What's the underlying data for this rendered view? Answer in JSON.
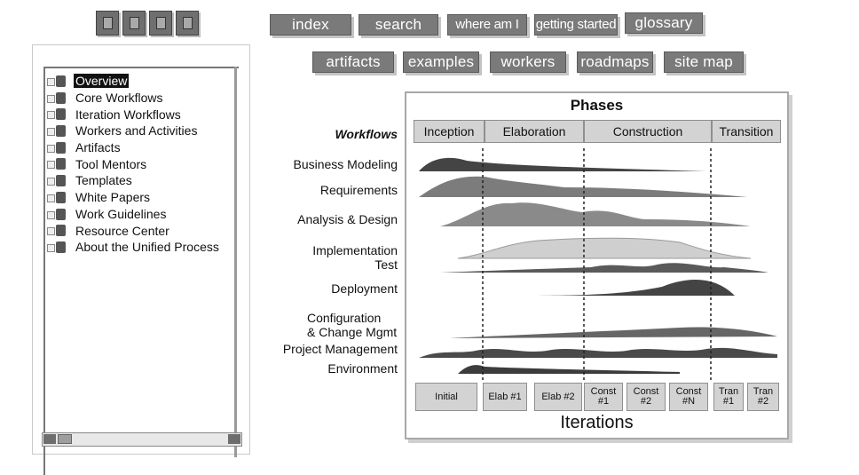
{
  "toolbar": {
    "icons": [
      "toolbar-icon-1",
      "toolbar-icon-2",
      "toolbar-icon-3",
      "toolbar-icon-4"
    ]
  },
  "nav": {
    "row1": [
      "index",
      "search",
      "where am I",
      "getting started",
      "glossary"
    ],
    "row2": [
      "artifacts",
      "examples",
      "workers",
      "roadmaps",
      "site map"
    ]
  },
  "tree": {
    "items": [
      {
        "label": "Overview",
        "selected": true
      },
      {
        "label": "Core Workflows"
      },
      {
        "label": "Iteration Workflows"
      },
      {
        "label": "Workers and Activities"
      },
      {
        "label": "Artifacts"
      },
      {
        "label": "Tool Mentors"
      },
      {
        "label": "Templates"
      },
      {
        "label": "White Papers"
      },
      {
        "label": "Work Guidelines"
      },
      {
        "label": "Resource Center"
      },
      {
        "label": "About the Unified Process"
      }
    ]
  },
  "diagram": {
    "title": "Phases",
    "workflows_heading": "Workflows",
    "phases": [
      "Inception",
      "Elaboration",
      "Construction",
      "Transition"
    ],
    "workflows": [
      "Business Modeling",
      "Requirements",
      "Analysis & Design",
      "Implementation",
      "Test",
      "Deployment",
      "Configuration\n& Change Mgmt",
      "Project Management",
      "Environment"
    ],
    "iterations": [
      "Initial",
      "Elab #1",
      "Elab #2",
      "Const\n#1",
      "Const\n#2",
      "Const\n#N",
      "Tran\n#1",
      "Tran\n#2"
    ],
    "iterations_label": "Iterations"
  }
}
